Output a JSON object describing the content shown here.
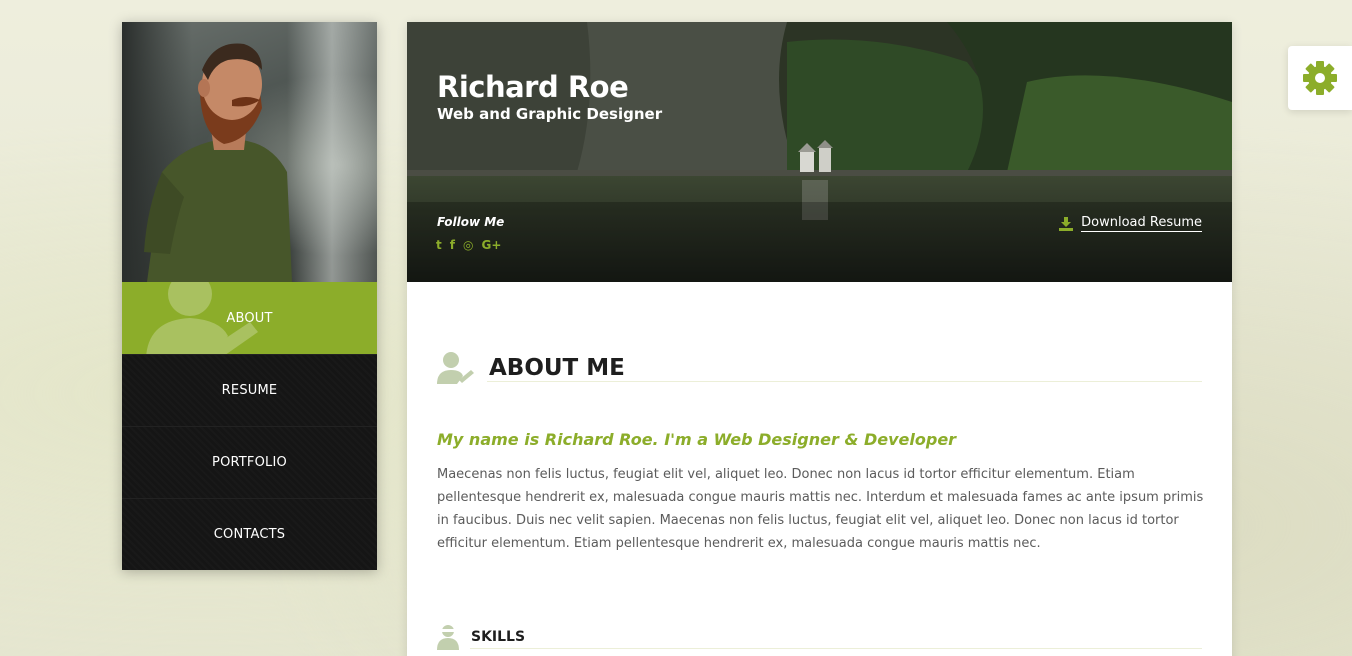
{
  "profile": {
    "name": "Richard Roe",
    "role": "Web and Graphic Designer"
  },
  "sidebar": {
    "items": [
      {
        "label": "ABOUT",
        "active": true
      },
      {
        "label": "RESUME",
        "active": false
      },
      {
        "label": "PORTFOLIO",
        "active": false
      },
      {
        "label": "CONTACTS",
        "active": false
      }
    ]
  },
  "header": {
    "follow_label": "Follow Me",
    "social": [
      {
        "icon": "twitter-icon",
        "glyph": "t"
      },
      {
        "icon": "facebook-icon",
        "glyph": "f"
      },
      {
        "icon": "instagram-icon",
        "glyph": "◎"
      },
      {
        "icon": "google-plus-icon",
        "glyph": "G+"
      }
    ],
    "download_label": "Download Resume"
  },
  "about": {
    "title": "ABOUT ME",
    "tagline": "My name is Richard Roe. I'm a Web Designer & Developer",
    "bio": "Maecenas non felis luctus, feugiat elit vel, aliquet leo. Donec non lacus id tortor efficitur elementum. Etiam pellentesque hendrerit ex, malesuada congue mauris mattis nec. Interdum et malesuada fames ac ante ipsum primis in faucibus. Duis nec velit sapien. Maecenas non felis luctus, feugiat elit vel, aliquet leo. Donec non lacus id tortor efficitur elementum. Etiam pellentesque hendrerit ex, malesuada congue mauris mattis nec."
  },
  "skills": {
    "title": "SKILLS"
  },
  "colors": {
    "accent": "#8cad2a",
    "sidebar_bg": "#151515",
    "text_dark": "#1e1e1e",
    "text_body": "#5b5b5b"
  }
}
